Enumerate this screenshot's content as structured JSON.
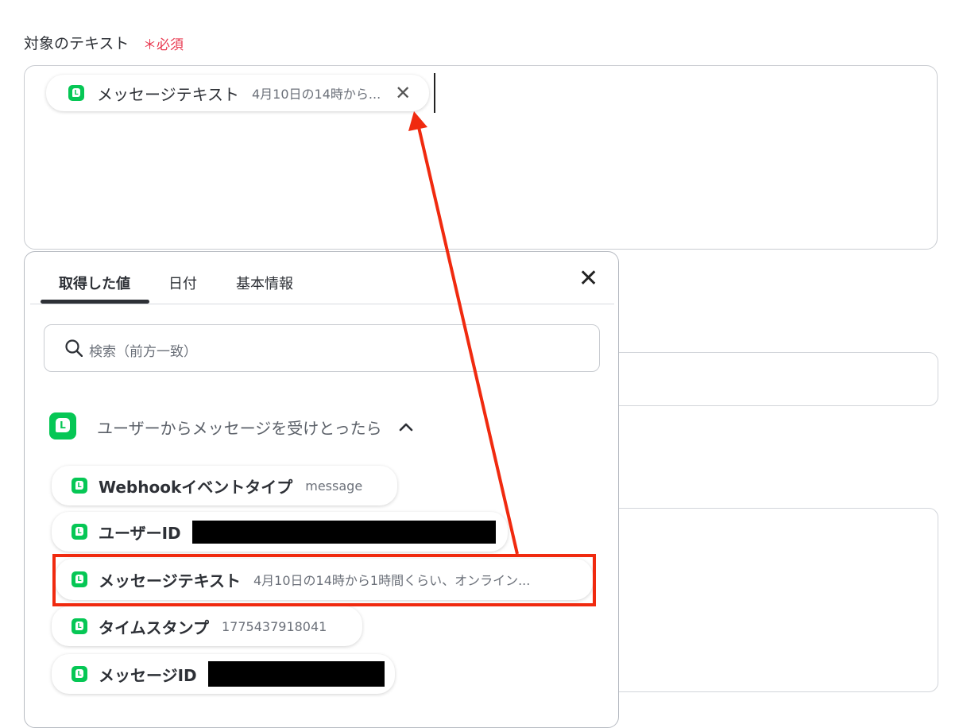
{
  "field": {
    "label": "対象のテキスト",
    "required": "＊必須"
  },
  "selected_chip": {
    "icon": "line-app-icon",
    "name": "メッセージテキスト",
    "value": "4月10日の14時から...",
    "remove_icon": "close-icon"
  },
  "picker": {
    "tabs": [
      {
        "label": "取得した値",
        "active": true
      },
      {
        "label": "日付",
        "active": false
      },
      {
        "label": "基本情報",
        "active": false
      }
    ],
    "close_icon": "close-icon",
    "search": {
      "icon": "search-icon",
      "placeholder": "検索（前方一致）"
    },
    "group": {
      "icon": "line-app-icon",
      "title": "ユーザーからメッセージを受けとったら",
      "toggle_icon": "chevron-up-icon"
    },
    "items": [
      {
        "name": "Webhookイベントタイプ",
        "value": "message",
        "redacted": false
      },
      {
        "name": "ユーザーID",
        "value": "",
        "redacted": true
      },
      {
        "name": "メッセージテキスト",
        "value": "4月10日の14時から1時間くらい、オンライン...",
        "redacted": false
      },
      {
        "name": "タイムスタンプ",
        "value": "1775437918041",
        "redacted": false
      },
      {
        "name": "メッセージID",
        "value": "",
        "redacted": true
      }
    ]
  },
  "annotation": {
    "highlight_color": "#f02a0f",
    "arrow_color": "#f02a0f"
  },
  "colors": {
    "line_green": "#06c755",
    "required_red": "#e8384f"
  }
}
